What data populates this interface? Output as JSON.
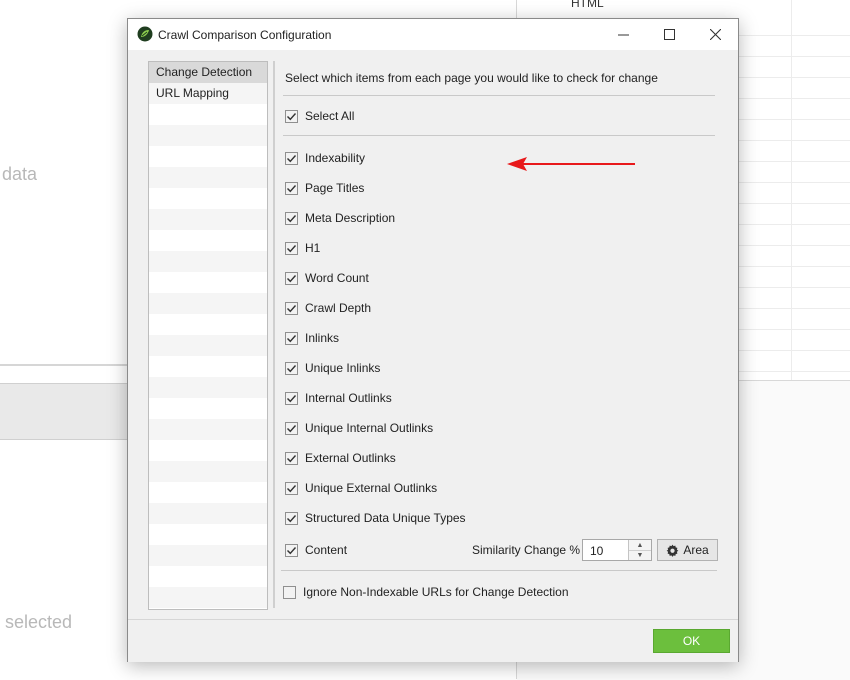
{
  "background": {
    "hint_top": "data",
    "hint_bottom": "selected",
    "grid_header": "HTML"
  },
  "dialog": {
    "title": "Crawl Comparison Configuration",
    "window_controls": {
      "minimize": "—",
      "maximize": "☐",
      "close": "✕"
    },
    "nav": [
      {
        "label": "Change Detection",
        "selected": true
      },
      {
        "label": "URL Mapping",
        "selected": false
      }
    ],
    "intro": "Select which items from each page you would like to check for change",
    "select_all": {
      "label": "Select All",
      "checked": true
    },
    "items": [
      {
        "label": "Indexability",
        "checked": true
      },
      {
        "label": "Page Titles",
        "checked": true
      },
      {
        "label": "Meta Description",
        "checked": true
      },
      {
        "label": "H1",
        "checked": true
      },
      {
        "label": "Word Count",
        "checked": true
      },
      {
        "label": "Crawl Depth",
        "checked": true
      },
      {
        "label": "Inlinks",
        "checked": true
      },
      {
        "label": "Unique Inlinks",
        "checked": true
      },
      {
        "label": "Internal Outlinks",
        "checked": true
      },
      {
        "label": "Unique Internal Outlinks",
        "checked": true
      },
      {
        "label": "External Outlinks",
        "checked": true
      },
      {
        "label": "Unique External Outlinks",
        "checked": true
      },
      {
        "label": "Structured Data Unique Types",
        "checked": true
      },
      {
        "label": "Content",
        "checked": true
      }
    ],
    "similarity": {
      "label": "Similarity Change %",
      "value": "10"
    },
    "area_button": "Area",
    "ignore_option": {
      "label": "Ignore Non-Indexable URLs for Change Detection",
      "checked": false
    },
    "ok_button": "OK"
  },
  "colors": {
    "ok_green": "#6cbf3d",
    "arrow_red": "#e8191b",
    "selected_nav": "#d9d9d9"
  }
}
